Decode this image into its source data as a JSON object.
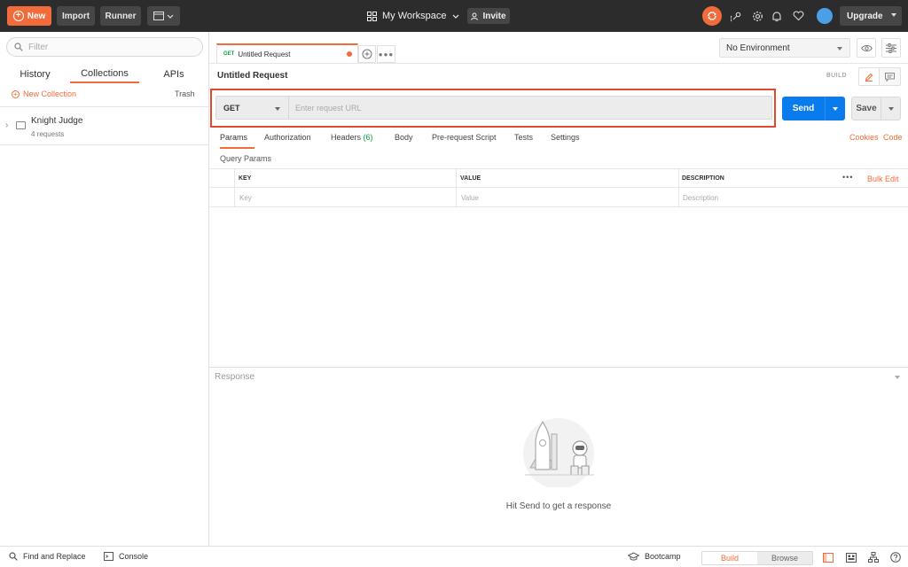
{
  "topbar": {
    "new_label": "New",
    "import_label": "Import",
    "runner_label": "Runner",
    "workspace_label": "My Workspace",
    "invite_label": "Invite",
    "upgrade_label": "Upgrade"
  },
  "sidebar": {
    "filter_placeholder": "Filter",
    "tabs": [
      {
        "label": "History"
      },
      {
        "label": "Collections",
        "active": true
      },
      {
        "label": "APIs"
      }
    ],
    "new_collection_label": "New Collection",
    "trash_label": "Trash",
    "collections": [
      {
        "name": "Knight Judge",
        "count": "4 requests"
      }
    ]
  },
  "request_tab": {
    "method": "GET",
    "title": "Untitled Request"
  },
  "environment": {
    "selected": "No Environment"
  },
  "request": {
    "title": "Untitled Request",
    "mode_label": "BUILD",
    "method": "GET",
    "url_value": "",
    "url_placeholder": "Enter request URL",
    "send_label": "Send",
    "save_label": "Save"
  },
  "param_tabs": [
    {
      "label": "Params",
      "active": true
    },
    {
      "label": "Authorization"
    },
    {
      "label": "Headers",
      "count": "(6)"
    },
    {
      "label": "Body"
    },
    {
      "label": "Pre-request Script"
    },
    {
      "label": "Tests"
    },
    {
      "label": "Settings"
    }
  ],
  "links": {
    "cookies": "Cookies",
    "code": "Code",
    "bulk_edit": "Bulk Edit"
  },
  "query_params": {
    "title": "Query Params",
    "headers": {
      "key": "KEY",
      "value": "VALUE",
      "description": "DESCRIPTION"
    },
    "placeholders": {
      "key": "Key",
      "value": "Value",
      "description": "Description"
    }
  },
  "response": {
    "label": "Response",
    "empty_text": "Hit Send to get a response"
  },
  "statusbar": {
    "find_replace": "Find and Replace",
    "console": "Console",
    "bootcamp": "Bootcamp",
    "build": "Build",
    "browse": "Browse"
  },
  "colors": {
    "accent": "#f26b3a",
    "send_blue": "#097bed",
    "topbar_bg": "#2c2c2c",
    "highlight_red": "#e04a2f",
    "get_green": "#0ba14b"
  }
}
